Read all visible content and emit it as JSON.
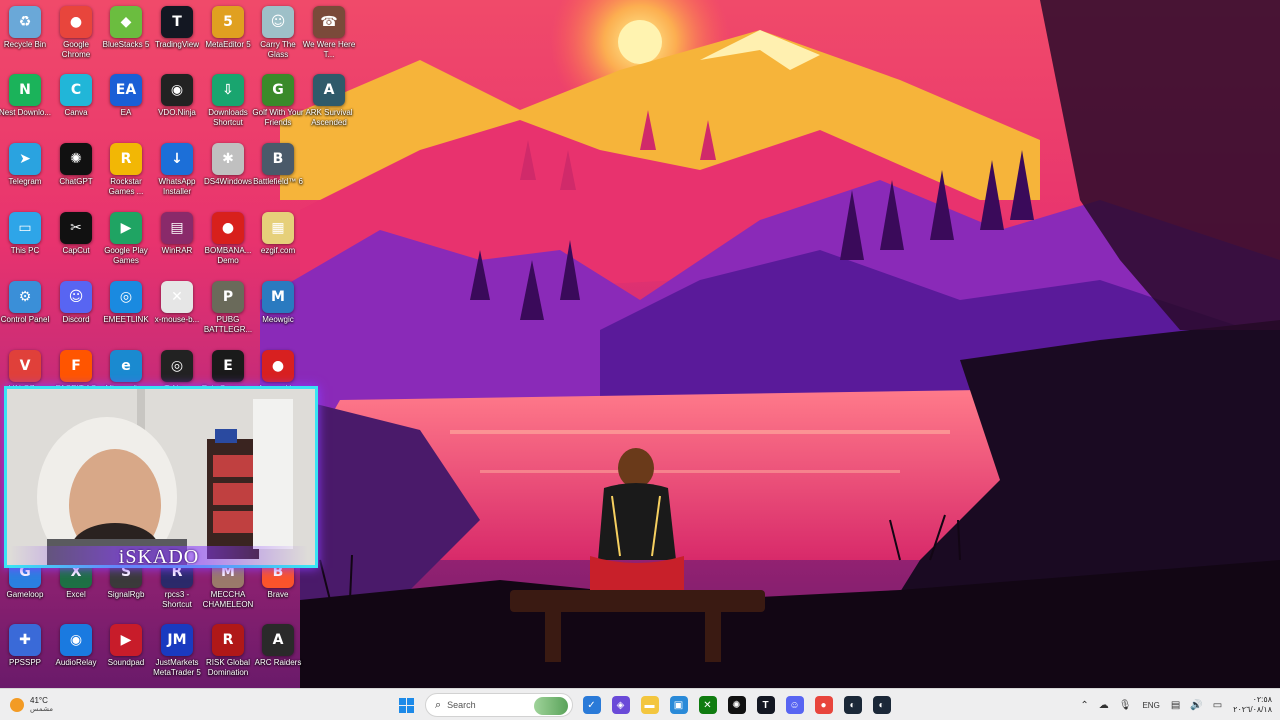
{
  "desktop": {
    "icons": [
      {
        "label": "Recycle Bin",
        "icon": "recycle-bin-icon",
        "color": "#6aa8d8",
        "glyph": "♻"
      },
      {
        "label": "Google Chrome",
        "icon": "chrome-icon",
        "color": "#e8453c",
        "glyph": "●"
      },
      {
        "label": "BlueStacks 5",
        "icon": "bluestacks-icon",
        "color": "#6bbd3f",
        "glyph": "◆"
      },
      {
        "label": "TradingView",
        "icon": "tradingview-icon",
        "color": "#131722",
        "glyph": "T"
      },
      {
        "label": "MetaEditor 5",
        "icon": "metaeditor-icon",
        "color": "#e0a020",
        "glyph": "5"
      },
      {
        "label": "Carry The Glass",
        "icon": "carry-glass-icon",
        "color": "#9ec0c8",
        "glyph": "☺"
      },
      {
        "label": "We Were Here T...",
        "icon": "we-were-here-icon",
        "color": "#7a4a3a",
        "glyph": "☎"
      },
      {
        "label": "Nest Downlo...",
        "icon": "nest-downloader-icon",
        "color": "#1bb35a",
        "glyph": "N"
      },
      {
        "label": "Canva",
        "icon": "canva-icon",
        "color": "#21b6d8",
        "glyph": "C"
      },
      {
        "label": "EA",
        "icon": "ea-icon",
        "color": "#1a5fd6",
        "glyph": "EA"
      },
      {
        "label": "VDO.Ninja",
        "icon": "vdo-ninja-icon",
        "color": "#222222",
        "glyph": "◉"
      },
      {
        "label": "Downloads Shortcut",
        "icon": "downloads-folder-icon",
        "color": "#19a56f",
        "glyph": "⇩"
      },
      {
        "label": "Golf With Your Friends",
        "icon": "golf-friends-icon",
        "color": "#3a8a2a",
        "glyph": "G"
      },
      {
        "label": "ARK Survival Ascended",
        "icon": "ark-icon",
        "color": "#2f5a6a",
        "glyph": "A"
      },
      {
        "label": "Telegram",
        "icon": "telegram-icon",
        "color": "#2aa3e0",
        "glyph": "➤"
      },
      {
        "label": "ChatGPT",
        "icon": "chatgpt-icon",
        "color": "#111111",
        "glyph": "✺"
      },
      {
        "label": "Rockstar Games ...",
        "icon": "rockstar-icon",
        "color": "#f2b705",
        "glyph": "R"
      },
      {
        "label": "WhatsApp Installer",
        "icon": "whatsapp-installer-icon",
        "color": "#1c6fd8",
        "glyph": "↓"
      },
      {
        "label": "DS4Windows",
        "icon": "ds4windows-icon",
        "color": "#c0c0c0",
        "glyph": "✱"
      },
      {
        "label": "Battlefield™ 6",
        "icon": "battlefield-icon",
        "color": "#4a5a6a",
        "glyph": "B"
      },
      {
        "label": "This PC",
        "icon": "this-pc-icon",
        "color": "#2ea5e8",
        "glyph": "▭"
      },
      {
        "label": "CapCut",
        "icon": "capcut-icon",
        "color": "#111111",
        "glyph": "✂"
      },
      {
        "label": "Google Play Games",
        "icon": "google-play-games-icon",
        "color": "#1fa463",
        "glyph": "▶"
      },
      {
        "label": "WinRAR",
        "icon": "winrar-icon",
        "color": "#8a2a6a",
        "glyph": "▤"
      },
      {
        "label": "BOMBANA... Demo",
        "icon": "bombanana-icon",
        "color": "#d8201c",
        "glyph": "●"
      },
      {
        "label": "ezgif.com",
        "icon": "ezgif-icon",
        "color": "#e6d07a",
        "glyph": "▦"
      },
      {
        "label": "Control Panel",
        "icon": "control-panel-icon",
        "color": "#3a8fd8",
        "glyph": "⚙"
      },
      {
        "label": "Discord",
        "icon": "discord-icon",
        "color": "#5865f2",
        "glyph": "☺"
      },
      {
        "label": "EMEETLINK",
        "icon": "emeetlink-icon",
        "color": "#1a8ae0",
        "glyph": "◎"
      },
      {
        "label": "x-mouse-b...",
        "icon": "xmouse-icon",
        "color": "#e6e6e6",
        "glyph": "✕"
      },
      {
        "label": "PUBG BATTLEGR...",
        "icon": "pubg-icon",
        "color": "#6a6a5a",
        "glyph": "P"
      },
      {
        "label": "Meowgic",
        "icon": "meowgic-icon",
        "color": "#2a7ac0",
        "glyph": "M"
      },
      {
        "label": "VALOZ...",
        "icon": "valorant-icon",
        "color": "#e0403a",
        "glyph": "V"
      },
      {
        "label": "FACEIT AC",
        "icon": "faceit-icon",
        "color": "#ff5500",
        "glyph": "F"
      },
      {
        "label": "Microsoft ...",
        "icon": "edge-icon",
        "color": "#1a8ad0",
        "glyph": "e"
      },
      {
        "label": "TsNo...",
        "icon": "tsno-icon",
        "color": "#222222",
        "glyph": "◎"
      },
      {
        "label": "Epic Games ...",
        "icon": "epic-games-icon",
        "color": "#1a1a1a",
        "glyph": "E"
      },
      {
        "label": "Among U...",
        "icon": "among-us-icon",
        "color": "#d82020",
        "glyph": "●"
      },
      {
        "label": "Gameloop",
        "icon": "gameloop-icon",
        "color": "#2a80e0",
        "glyph": "G"
      },
      {
        "label": "Excel",
        "icon": "excel-icon",
        "color": "#1d7044",
        "glyph": "X"
      },
      {
        "label": "SignalRgb",
        "icon": "signalrgb-icon",
        "color": "#3a3a3a",
        "glyph": "S"
      },
      {
        "label": "rpcs3 - Shortcut",
        "icon": "rpcs3-icon",
        "color": "#2a2a6a",
        "glyph": "R"
      },
      {
        "label": "MECCHA CHAMELEON",
        "icon": "meccha-icon",
        "color": "#9a7a6a",
        "glyph": "M"
      },
      {
        "label": "Brave",
        "icon": "brave-icon",
        "color": "#fb542b",
        "glyph": "B"
      },
      {
        "label": "PPSSPP",
        "icon": "ppsspp-icon",
        "color": "#3a6ad8",
        "glyph": "✚"
      },
      {
        "label": "AudioRelay",
        "icon": "audiorelay-icon",
        "color": "#1a7ae0",
        "glyph": "◉"
      },
      {
        "label": "Soundpad",
        "icon": "soundpad-icon",
        "color": "#c81c2a",
        "glyph": "▶"
      },
      {
        "label": "JustMarkets MetaTrader 5",
        "icon": "metatrader-icon",
        "color": "#1a3ac0",
        "glyph": "JM"
      },
      {
        "label": "RISK Global Domination",
        "icon": "risk-icon",
        "color": "#b01818",
        "glyph": "R"
      },
      {
        "label": "ARC Raiders",
        "icon": "arc-raiders-icon",
        "color": "#2a2a2a",
        "glyph": "A"
      }
    ]
  },
  "webcam": {
    "streamer_name": "iSKADO"
  },
  "taskbar": {
    "weather": {
      "temp": "41°C",
      "condition": "مشمس"
    },
    "search_placeholder": "Search",
    "pinned": [
      {
        "icon": "todo-app-icon",
        "color": "#2a7ad8",
        "glyph": "✓"
      },
      {
        "icon": "app-tray-icon",
        "color": "#6a4ad8",
        "glyph": "◈"
      },
      {
        "icon": "file-explorer-icon",
        "color": "#f3c63f",
        "glyph": "▬"
      },
      {
        "icon": "microsoft-store-icon",
        "color": "#2a8ad8",
        "glyph": "▣"
      },
      {
        "icon": "xbox-icon",
        "color": "#107c10",
        "glyph": "✕"
      },
      {
        "icon": "chatgpt-taskbar-icon",
        "color": "#111111",
        "glyph": "✺"
      },
      {
        "icon": "tradingview-taskbar-icon",
        "color": "#131722",
        "glyph": "T"
      },
      {
        "icon": "discord-taskbar-icon",
        "color": "#5865f2",
        "glyph": "☺"
      },
      {
        "icon": "chrome-taskbar-icon",
        "color": "#e8453c",
        "glyph": "●"
      },
      {
        "icon": "steam-icon",
        "color": "#1b2838",
        "glyph": "◐"
      },
      {
        "icon": "steam-taskbar-icon",
        "color": "#1b2838",
        "glyph": "◐"
      }
    ],
    "tray": {
      "language": "ENG",
      "time": "٠٢:٥٨",
      "date": "٢٠٢٦/٠٨/١٨"
    }
  }
}
